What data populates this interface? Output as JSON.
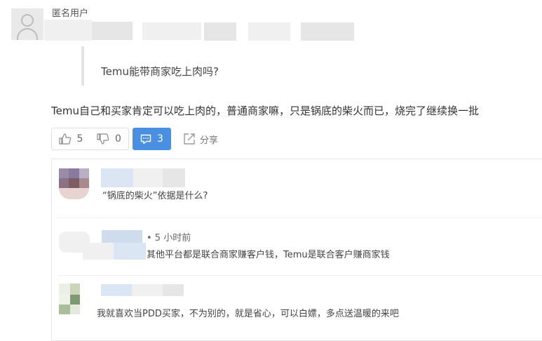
{
  "header": {
    "username": "匿名用户"
  },
  "question": {
    "title": "Temu能带商家吃上肉吗?"
  },
  "answer": {
    "text": "Temu自己和买家肯定可以吃上肉的，普通商家嘛，只是锅底的柴火而已，烧完了继续换一批"
  },
  "actions": {
    "upvote_count": "5",
    "downvote_count": "0",
    "comment_count": "3",
    "share_label": "分享"
  },
  "comments": [
    {
      "text": "“锅底的柴火”依据是什么?"
    },
    {
      "time": "• 5 小时前",
      "text": "其他平台都是联合商家赚客户钱，Temu是联合客户赚商家钱"
    },
    {
      "text": "我就喜欢当PDD买家，不为别的，就是省心，可以白嫖，多点送温暖的来吧"
    }
  ],
  "colors": {
    "accent": "#4a90e2",
    "divider": "#eeeeee",
    "text": "#333333"
  }
}
